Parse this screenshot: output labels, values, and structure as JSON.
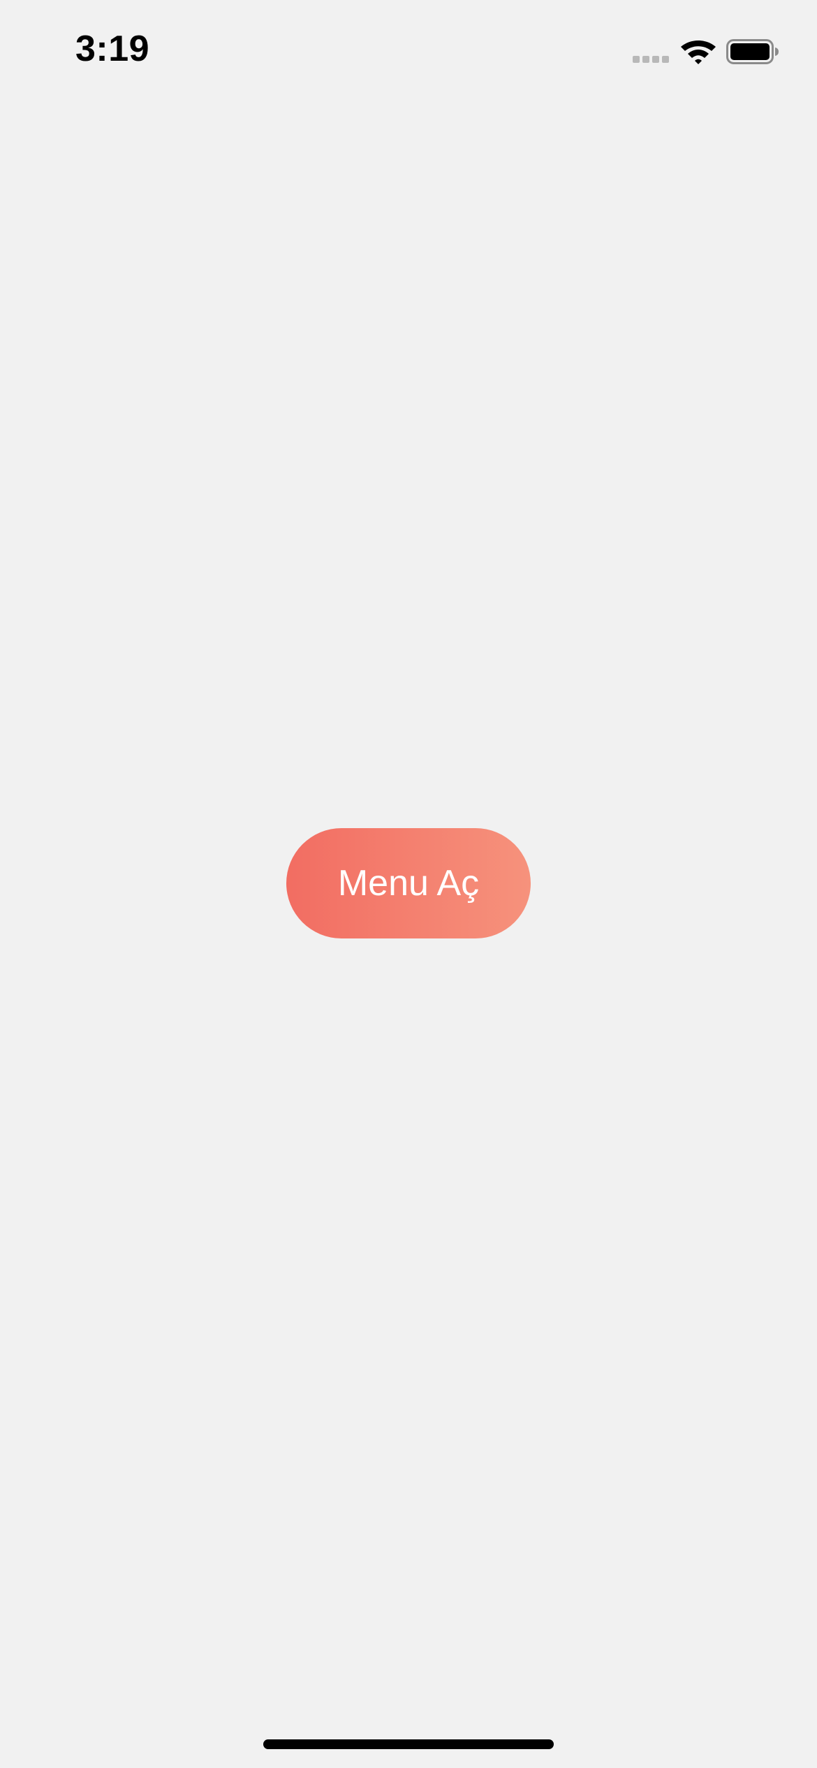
{
  "status_bar": {
    "time": "3:19",
    "icons": [
      "signal-icon",
      "wifi-icon",
      "battery-icon"
    ]
  },
  "main": {
    "menu_button_label": "Menu Aç"
  },
  "colors": {
    "background": "#f1f1f1",
    "button_gradient_start": "#f26d62",
    "button_gradient_end": "#f6927c",
    "button_text": "#ffffff"
  }
}
